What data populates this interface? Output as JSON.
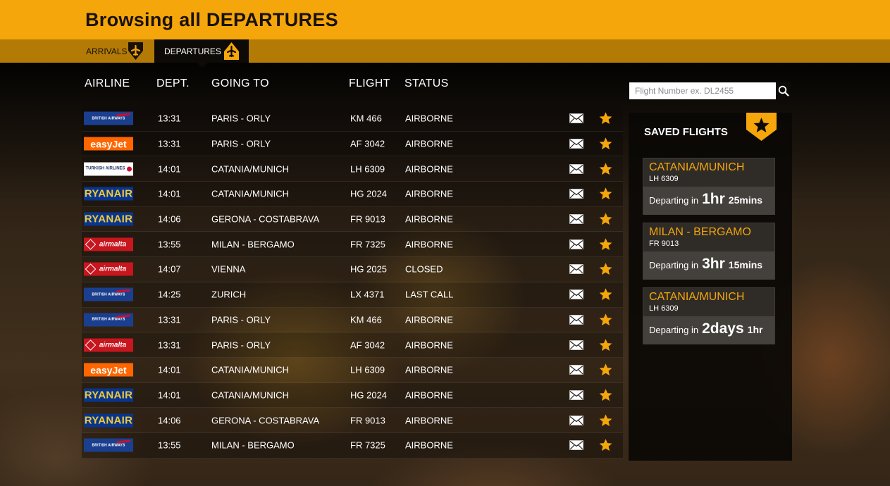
{
  "header": {
    "title": "Browsing all DEPARTURES"
  },
  "tabs": [
    {
      "label": "ARRIVALS"
    },
    {
      "label": "DEPARTURES"
    }
  ],
  "search": {
    "placeholder": "Flight Number ex. DL2455"
  },
  "columns": {
    "airline": "AIRLINE",
    "dept": "DEPT.",
    "going_to": "GOING TO",
    "flight": "FLIGHT",
    "status": "STATUS"
  },
  "rows": [
    {
      "airline": "British Airways",
      "time": "13:31",
      "dest": "PARIS - ORLY",
      "flight": "KM 466",
      "status": "AIRBORNE"
    },
    {
      "airline": "easyJet",
      "time": "13:31",
      "dest": "PARIS - ORLY",
      "flight": "AF 3042",
      "status": "AIRBORNE"
    },
    {
      "airline": "Turkish Airlines",
      "time": "14:01",
      "dest": "CATANIA/MUNICH",
      "flight": "LH 6309",
      "status": "AIRBORNE"
    },
    {
      "airline": "Ryanair",
      "time": "14:01",
      "dest": "CATANIA/MUNICH",
      "flight": "HG 2024",
      "status": "AIRBORNE"
    },
    {
      "airline": "Ryanair",
      "time": "14:06",
      "dest": "GERONA - COSTABRAVA",
      "flight": "FR 9013",
      "status": "AIRBORNE"
    },
    {
      "airline": "airmalta",
      "time": "13:55",
      "dest": "MILAN - BERGAMO",
      "flight": "FR 7325",
      "status": "AIRBORNE"
    },
    {
      "airline": "airmalta",
      "time": "14:07",
      "dest": "VIENNA",
      "flight": "HG 2025",
      "status": "CLOSED"
    },
    {
      "airline": "British Airways",
      "time": "14:25",
      "dest": "ZURICH",
      "flight": "LX 4371",
      "status": "LAST CALL"
    },
    {
      "airline": "British Airways",
      "time": "13:31",
      "dest": "PARIS - ORLY",
      "flight": "KM 466",
      "status": "AIRBORNE"
    },
    {
      "airline": "airmalta",
      "time": "13:31",
      "dest": "PARIS - ORLY",
      "flight": "AF 3042",
      "status": "AIRBORNE"
    },
    {
      "airline": "easyJet",
      "time": "14:01",
      "dest": "CATANIA/MUNICH",
      "flight": "LH 6309",
      "status": "AIRBORNE"
    },
    {
      "airline": "Ryanair",
      "time": "14:01",
      "dest": "CATANIA/MUNICH",
      "flight": "HG 2024",
      "status": "AIRBORNE"
    },
    {
      "airline": "Ryanair",
      "time": "14:06",
      "dest": "GERONA - COSTABRAVA",
      "flight": "FR 9013",
      "status": "AIRBORNE"
    },
    {
      "airline": "British Airways",
      "time": "13:55",
      "dest": "MILAN - BERGAMO",
      "flight": "FR 7325",
      "status": "AIRBORNE"
    }
  ],
  "logos": {
    "ba": "BRITISH AIRWAYS",
    "ez": "easyJet",
    "tk": "TURKISH AIRLINES",
    "fr": "RYANAIR",
    "km": "airmalta"
  },
  "saved": {
    "title": "SAVED FLIGHTS",
    "departing_label": "Departing in",
    "cards": [
      {
        "dest": "CATANIA/MUNICH",
        "flight": "LH 6309",
        "big": "1hr",
        "small": "25mins"
      },
      {
        "dest": "MILAN - BERGAMO",
        "flight": "FR 9013",
        "big": "3hr",
        "small": "15mins"
      },
      {
        "dest": "CATANIA/MUNICH",
        "flight": "LH 6309",
        "big": "2days",
        "small": "1hr"
      }
    ]
  },
  "colors": {
    "accent": "#f5a60a",
    "tabbar": "#b37b06",
    "panel": "#0d0a07"
  },
  "icons": {
    "arrivals": "plane-arriving-icon",
    "departures": "plane-departing-icon",
    "search": "search-icon",
    "mail": "mail-icon",
    "star": "star-icon"
  }
}
